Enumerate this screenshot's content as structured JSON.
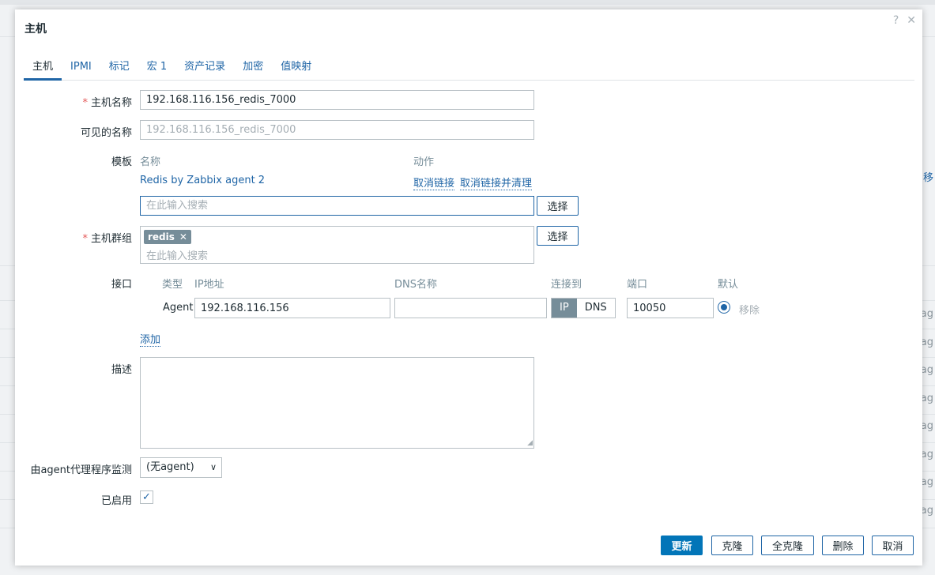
{
  "dialog": {
    "title": "主机",
    "help_icon": "help-icon",
    "close_icon": "close-icon"
  },
  "tabs": [
    {
      "label": "主机",
      "active": true
    },
    {
      "label": "IPMI"
    },
    {
      "label": "标记"
    },
    {
      "label": "宏 1"
    },
    {
      "label": "资产记录"
    },
    {
      "label": "加密"
    },
    {
      "label": "值映射"
    }
  ],
  "form": {
    "host_name_label": "主机名称",
    "host_name_value": "192.168.116.156_redis_7000",
    "visible_name_label": "可见的名称",
    "visible_name_value": "192.168.116.156_redis_7000",
    "templates_label": "模板",
    "templates_col_name": "名称",
    "templates_col_action": "动作",
    "template_link": "Redis by Zabbix agent 2",
    "unlink_label": "取消链接",
    "unlink_clear_label": "取消链接并清理",
    "search_placeholder": "在此输入搜索",
    "select_label": "选择",
    "host_groups_label": "主机群组",
    "group_chip": "redis",
    "interfaces_label": "接口",
    "iface_col_type": "类型",
    "iface_col_ip": "IP地址",
    "iface_col_dns": "DNS名称",
    "iface_col_connect": "连接到",
    "iface_col_port": "端口",
    "iface_col_default": "默认",
    "iface_type": "Agent",
    "iface_ip": "192.168.116.156",
    "iface_dns": "",
    "iface_connect_ip": "IP",
    "iface_connect_dns": "DNS",
    "iface_port": "10050",
    "iface_remove": "移除",
    "add_label": "添加",
    "description_label": "描述",
    "proxy_label": "由agent代理程序监测",
    "proxy_value": "(无agent)",
    "enabled_label": "已启用",
    "enabled_checked": true
  },
  "footer": {
    "update": "更新",
    "clone": "克隆",
    "full_clone": "全克隆",
    "delete": "删除",
    "cancel": "取消"
  },
  "background": {
    "right_link": "移",
    "right_text": "ag"
  },
  "colors": {
    "accent": "#1f65a6",
    "primary_button": "#0275b8",
    "required": "#e45959",
    "chip": "#768d99"
  }
}
